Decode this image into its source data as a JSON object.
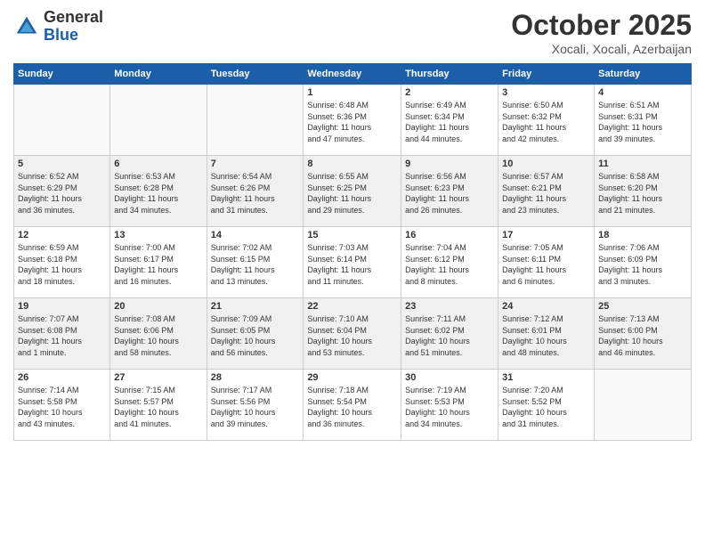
{
  "logo": {
    "general": "General",
    "blue": "Blue"
  },
  "title": "October 2025",
  "subtitle": "Xocali, Xocali, Azerbaijan",
  "days_of_week": [
    "Sunday",
    "Monday",
    "Tuesday",
    "Wednesday",
    "Thursday",
    "Friday",
    "Saturday"
  ],
  "weeks": [
    [
      {
        "day": "",
        "info": ""
      },
      {
        "day": "",
        "info": ""
      },
      {
        "day": "",
        "info": ""
      },
      {
        "day": "1",
        "info": "Sunrise: 6:48 AM\nSunset: 6:36 PM\nDaylight: 11 hours\nand 47 minutes."
      },
      {
        "day": "2",
        "info": "Sunrise: 6:49 AM\nSunset: 6:34 PM\nDaylight: 11 hours\nand 44 minutes."
      },
      {
        "day": "3",
        "info": "Sunrise: 6:50 AM\nSunset: 6:32 PM\nDaylight: 11 hours\nand 42 minutes."
      },
      {
        "day": "4",
        "info": "Sunrise: 6:51 AM\nSunset: 6:31 PM\nDaylight: 11 hours\nand 39 minutes."
      }
    ],
    [
      {
        "day": "5",
        "info": "Sunrise: 6:52 AM\nSunset: 6:29 PM\nDaylight: 11 hours\nand 36 minutes."
      },
      {
        "day": "6",
        "info": "Sunrise: 6:53 AM\nSunset: 6:28 PM\nDaylight: 11 hours\nand 34 minutes."
      },
      {
        "day": "7",
        "info": "Sunrise: 6:54 AM\nSunset: 6:26 PM\nDaylight: 11 hours\nand 31 minutes."
      },
      {
        "day": "8",
        "info": "Sunrise: 6:55 AM\nSunset: 6:25 PM\nDaylight: 11 hours\nand 29 minutes."
      },
      {
        "day": "9",
        "info": "Sunrise: 6:56 AM\nSunset: 6:23 PM\nDaylight: 11 hours\nand 26 minutes."
      },
      {
        "day": "10",
        "info": "Sunrise: 6:57 AM\nSunset: 6:21 PM\nDaylight: 11 hours\nand 23 minutes."
      },
      {
        "day": "11",
        "info": "Sunrise: 6:58 AM\nSunset: 6:20 PM\nDaylight: 11 hours\nand 21 minutes."
      }
    ],
    [
      {
        "day": "12",
        "info": "Sunrise: 6:59 AM\nSunset: 6:18 PM\nDaylight: 11 hours\nand 18 minutes."
      },
      {
        "day": "13",
        "info": "Sunrise: 7:00 AM\nSunset: 6:17 PM\nDaylight: 11 hours\nand 16 minutes."
      },
      {
        "day": "14",
        "info": "Sunrise: 7:02 AM\nSunset: 6:15 PM\nDaylight: 11 hours\nand 13 minutes."
      },
      {
        "day": "15",
        "info": "Sunrise: 7:03 AM\nSunset: 6:14 PM\nDaylight: 11 hours\nand 11 minutes."
      },
      {
        "day": "16",
        "info": "Sunrise: 7:04 AM\nSunset: 6:12 PM\nDaylight: 11 hours\nand 8 minutes."
      },
      {
        "day": "17",
        "info": "Sunrise: 7:05 AM\nSunset: 6:11 PM\nDaylight: 11 hours\nand 6 minutes."
      },
      {
        "day": "18",
        "info": "Sunrise: 7:06 AM\nSunset: 6:09 PM\nDaylight: 11 hours\nand 3 minutes."
      }
    ],
    [
      {
        "day": "19",
        "info": "Sunrise: 7:07 AM\nSunset: 6:08 PM\nDaylight: 11 hours\nand 1 minute."
      },
      {
        "day": "20",
        "info": "Sunrise: 7:08 AM\nSunset: 6:06 PM\nDaylight: 10 hours\nand 58 minutes."
      },
      {
        "day": "21",
        "info": "Sunrise: 7:09 AM\nSunset: 6:05 PM\nDaylight: 10 hours\nand 56 minutes."
      },
      {
        "day": "22",
        "info": "Sunrise: 7:10 AM\nSunset: 6:04 PM\nDaylight: 10 hours\nand 53 minutes."
      },
      {
        "day": "23",
        "info": "Sunrise: 7:11 AM\nSunset: 6:02 PM\nDaylight: 10 hours\nand 51 minutes."
      },
      {
        "day": "24",
        "info": "Sunrise: 7:12 AM\nSunset: 6:01 PM\nDaylight: 10 hours\nand 48 minutes."
      },
      {
        "day": "25",
        "info": "Sunrise: 7:13 AM\nSunset: 6:00 PM\nDaylight: 10 hours\nand 46 minutes."
      }
    ],
    [
      {
        "day": "26",
        "info": "Sunrise: 7:14 AM\nSunset: 5:58 PM\nDaylight: 10 hours\nand 43 minutes."
      },
      {
        "day": "27",
        "info": "Sunrise: 7:15 AM\nSunset: 5:57 PM\nDaylight: 10 hours\nand 41 minutes."
      },
      {
        "day": "28",
        "info": "Sunrise: 7:17 AM\nSunset: 5:56 PM\nDaylight: 10 hours\nand 39 minutes."
      },
      {
        "day": "29",
        "info": "Sunrise: 7:18 AM\nSunset: 5:54 PM\nDaylight: 10 hours\nand 36 minutes."
      },
      {
        "day": "30",
        "info": "Sunrise: 7:19 AM\nSunset: 5:53 PM\nDaylight: 10 hours\nand 34 minutes."
      },
      {
        "day": "31",
        "info": "Sunrise: 7:20 AM\nSunset: 5:52 PM\nDaylight: 10 hours\nand 31 minutes."
      },
      {
        "day": "",
        "info": ""
      }
    ]
  ]
}
